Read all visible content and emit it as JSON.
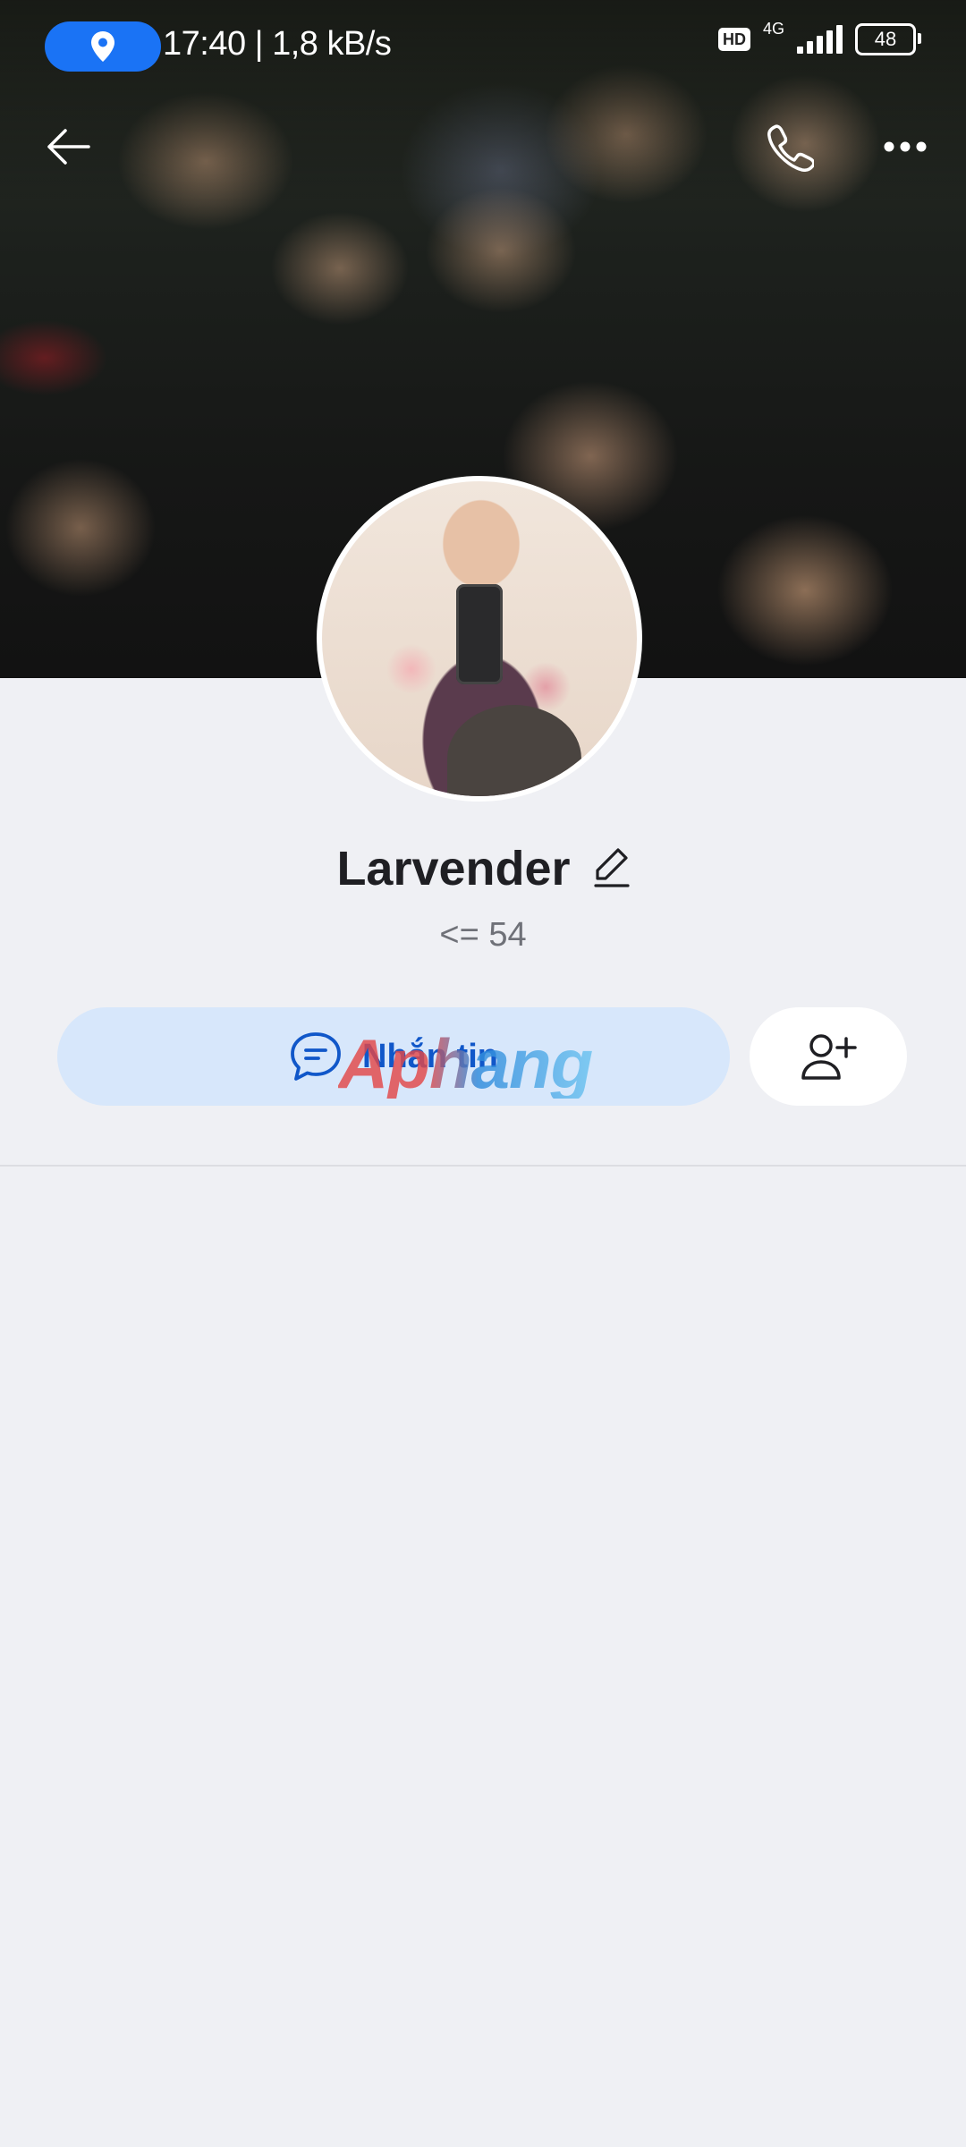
{
  "status_bar": {
    "time_speed": "17:40 | 1,8 kB/s",
    "hd": "HD",
    "network": "4G",
    "battery": "48"
  },
  "nav": {
    "back_icon": "arrow-left-icon",
    "call_icon": "phone-icon",
    "more_icon": "more-dots-icon"
  },
  "profile": {
    "name": "Larvender",
    "subtitle": "<= 54",
    "message_label": "Nhắn tin",
    "watermark": "Aphang"
  },
  "colors": {
    "accent": "#1057c9",
    "message_bg": "#d7e7fb",
    "page_bg": "#eff0f4",
    "location_pill": "#1a73f5"
  }
}
